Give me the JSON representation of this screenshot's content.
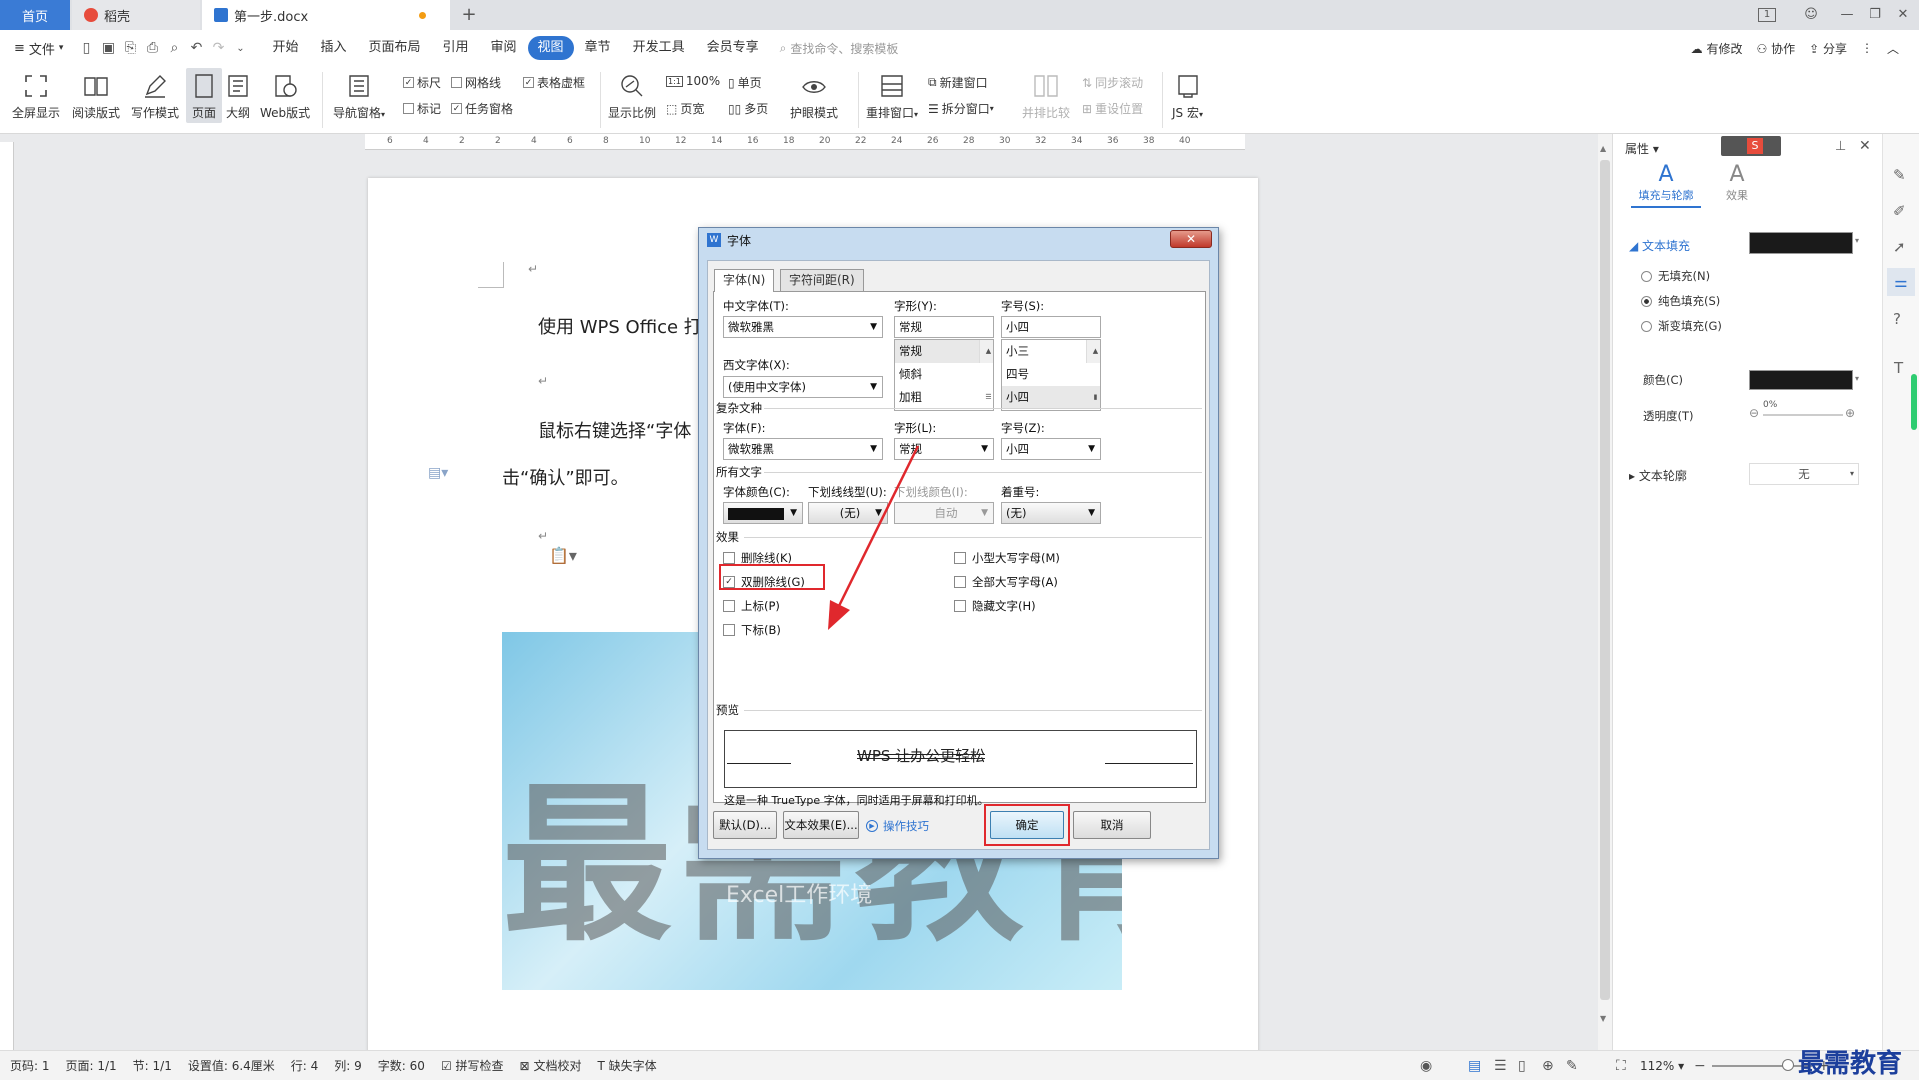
{
  "titlebar": {
    "tabs": [
      {
        "label": "首页"
      },
      {
        "label": "稻壳"
      },
      {
        "label": "第一步.docx"
      }
    ],
    "new_tab": "+",
    "page_indicator": "1"
  },
  "menubar": {
    "file": "文件",
    "items": [
      "开始",
      "插入",
      "页面布局",
      "引用",
      "审阅",
      "视图",
      "章节",
      "开发工具",
      "会员专享"
    ],
    "active": "视图",
    "search_placeholder": "查找命令、搜索模板",
    "right": [
      "有修改",
      "协作",
      "分享"
    ]
  },
  "ribbon": {
    "fullscreen": "全屏显示",
    "read_mode": "阅读版式",
    "write_mode": "写作模式",
    "page": "页面",
    "outline": "大纲",
    "web": "Web版式",
    "nav_pane": "导航窗格",
    "ruler": "标尺",
    "gridlines": "网格线",
    "table_gridlines": "表格虚框",
    "mark": "标记",
    "task_pane": "任务窗格",
    "zoom_ratio": "显示比例",
    "zoom_100": "100%",
    "single_page": "单页",
    "page_width": "页宽",
    "multi_page": "多页",
    "eye_mode": "护眼模式",
    "arrange": "重排窗口",
    "new_window": "新建窗口",
    "split_window": "拆分窗口",
    "side_by_side": "并排比较",
    "sync_scroll": "同步滚动",
    "reset_position": "重设位置",
    "js_macro": "JS 宏"
  },
  "ruler": {
    "ticks": [
      "6",
      "4",
      "2",
      "2",
      "4",
      "6",
      "8",
      "10",
      "12",
      "14",
      "16",
      "18",
      "20",
      "22",
      "24",
      "26",
      "28",
      "30",
      "32",
      "34",
      "36",
      "38",
      "40"
    ]
  },
  "document": {
    "line1": "使用 WPS Office 打开",
    "line2": "鼠标右键选择“字体",
    "line3": "击“确认”即可。",
    "return_mark": "↵",
    "watermark_big": "最需教育",
    "watermark_small": "Excel工作环境"
  },
  "dialog": {
    "title": "字体",
    "tabs": [
      "字体(N)",
      "字符间距(R)"
    ],
    "cn_font_label": "中文字体(T):",
    "cn_font_value": "微软雅黑",
    "style_label": "字形(Y):",
    "style_value": "常规",
    "style_options": [
      "常规",
      "倾斜",
      "加粗"
    ],
    "size_label": "字号(S):",
    "size_value": "小四",
    "size_options": [
      "小三",
      "四号",
      "小四"
    ],
    "west_font_label": "西文字体(X):",
    "west_font_value": "(使用中文字体)",
    "complex_group": "复杂文种",
    "complex_font_label": "字体(F):",
    "complex_font_value": "微软雅黑",
    "complex_style_label": "字形(L):",
    "complex_style_value": "常规",
    "complex_size_label": "字号(Z):",
    "complex_size_value": "小四",
    "all_text_group": "所有文字",
    "font_color_label": "字体颜色(C):",
    "underline_label": "下划线线型(U):",
    "underline_value": "(无)",
    "underline_color_label": "下划线颜色(I):",
    "underline_color_value": "自动",
    "emphasis_label": "着重号:",
    "emphasis_value": "(无)",
    "effects_group": "效果",
    "effects": [
      {
        "label": "删除线(K)",
        "checked": false
      },
      {
        "label": "双删除线(G)",
        "checked": true
      },
      {
        "label": "上标(P)",
        "checked": false
      },
      {
        "label": "下标(B)",
        "checked": false
      },
      {
        "label": "小型大写字母(M)",
        "checked": false
      },
      {
        "label": "全部大写字母(A)",
        "checked": false
      },
      {
        "label": "隐藏文字(H)",
        "checked": false
      }
    ],
    "preview_group": "预览",
    "preview_text": "WPS 让办公更轻松",
    "preview_note": "这是一种 TrueType 字体，同时适用于屏幕和打印机。",
    "default_btn": "默认(D)...",
    "text_effect_btn": "文本效果(E)...",
    "tips_link": "操作技巧",
    "ok_btn": "确定",
    "cancel_btn": "取消",
    "check_mark": "✓"
  },
  "right_panel": {
    "title": "属性",
    "tab_fill": "填充与轮廓",
    "tab_effect": "效果",
    "text_fill": "文本填充",
    "no_fill": "无填充(N)",
    "solid_fill": "纯色填充(S)",
    "gradient_fill": "渐变填充(G)",
    "color_label": "颜色(C)",
    "transparency_label": "透明度(T)",
    "transparency_value": "0%",
    "text_outline": "文本轮廓",
    "outline_value": "无"
  },
  "statusbar": {
    "page_num": "页码: 1",
    "page_count": "页面: 1/1",
    "section": "节: 1/1",
    "setting": "设置值: 6.4厘米",
    "row": "行: 4",
    "col": "列: 9",
    "word_count": "字数: 60",
    "spell_check": "拼写检查",
    "doc_check": "文档校对",
    "missing_font": "缺失字体",
    "zoom": "112%",
    "brand": "最需教育"
  },
  "colors": {
    "accent": "#2f74d0",
    "highlight": "#e0282d",
    "font_color": "#111111"
  }
}
